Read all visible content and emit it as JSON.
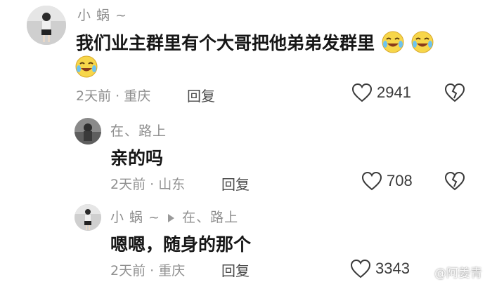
{
  "comments": [
    {
      "username": "小 蜗 ~",
      "text": "我们业主群里有个大哥把他弟弟发群里",
      "emoji_icon": "laugh-cry-emoji-icon",
      "meta": "2天前 · 重庆",
      "reply_label": "回复",
      "like_count": "2941"
    },
    {
      "username": "在、路上",
      "text": "亲的吗",
      "meta": "2天前 · 山东",
      "reply_label": "回复",
      "like_count": "708"
    },
    {
      "username": "小 蜗 ~",
      "reply_to": "在、路上",
      "text": "嗯嗯，随身的那个",
      "meta": "2天前 · 重庆",
      "reply_label": "回复",
      "like_count": "3343"
    }
  ],
  "watermark": "@阿姜青",
  "colors": {
    "username": "#8f8f8f",
    "text": "#161616",
    "meta": "#8f8f8f",
    "emoji_face": "#f7d64a"
  }
}
